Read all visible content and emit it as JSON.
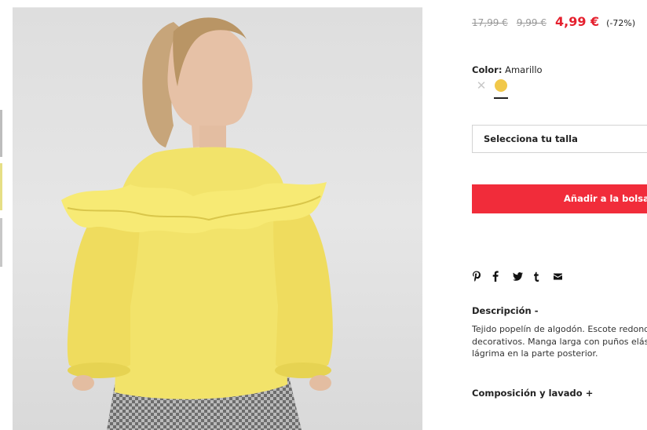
{
  "product": {
    "image_alt": "Blusa volante amarilla",
    "prices": {
      "original": "17,99 €",
      "previous": "9,99 €",
      "current": "4,99 €",
      "discount": "(-72%)"
    },
    "color": {
      "label": "Color:",
      "value": "Amarillo",
      "swatches": [
        {
          "name": "unavailable",
          "icon": "x-icon"
        },
        {
          "name": "Amarillo",
          "hex": "#f1c84a",
          "selected": true
        }
      ]
    },
    "size_select": {
      "placeholder": "Selecciona tu talla"
    },
    "add_to_bag": "Añadir a la bolsa",
    "share": [
      "pinterest-icon",
      "facebook-icon",
      "twitter-icon",
      "tumblr-icon",
      "email-icon"
    ],
    "description": {
      "title": "Descripción -",
      "lines": [
        "Tejido popelín de algodón. Escote redondo",
        "decorativos. Manga larga con puños elástic",
        "lágrima en la parte posterior."
      ]
    },
    "composition_title": "Composición y lavado +"
  },
  "colors": {
    "accent_red": "#f12c3a",
    "price_red": "#e5202e",
    "garment_yellow": "#f2e36a"
  }
}
